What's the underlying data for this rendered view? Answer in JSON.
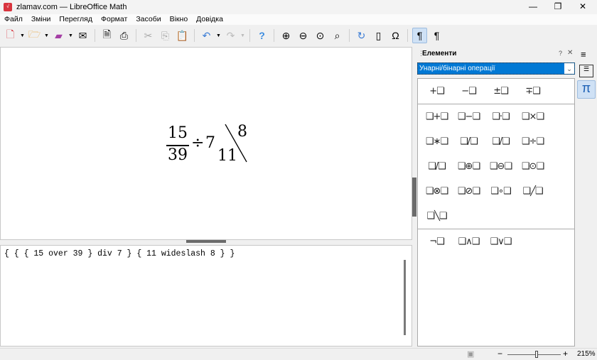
{
  "window": {
    "title": "zlamav.com — LibreOffice Math",
    "minimize": "—",
    "maximize": "❐",
    "close": "✕"
  },
  "menu": [
    "Файл",
    "Зміни",
    "Перегляд",
    "Формат",
    "Засоби",
    "Вікно",
    "Довідка"
  ],
  "formula": {
    "num": "15",
    "den": "39",
    "div": "÷",
    "divisor": "7",
    "ws_left": "11",
    "ws_right": "8"
  },
  "command_text": "{ { { 15 over 39 } div 7 } { 11 wideslash 8 } }",
  "sidebar": {
    "title": "Елементи",
    "help": "?",
    "close": "✕",
    "menu": "≡",
    "category": "Унарні/бінарні операції",
    "groups": [
      [
        "+❑",
        "−❑",
        "±❑",
        "∓❑"
      ],
      [
        "❑+❑",
        "❑−❑",
        "❑·❑",
        "❑×❑",
        "❑∗❑",
        "❑/❑ over",
        "❑/❑ frac",
        "❑÷❑",
        "❑/❑",
        "❑⊕❑",
        "❑⊖❑",
        "❑⊙❑",
        "❑⊗❑",
        "❑⊘❑",
        "❑∘❑",
        "❑╱❑",
        "❑╲❑"
      ],
      [
        "¬❑",
        "❑∧❑",
        "❑∨❑"
      ]
    ]
  },
  "status": {
    "zoom": "215%",
    "zoom_level": 0.55,
    "minus": "−",
    "plus": "+"
  }
}
